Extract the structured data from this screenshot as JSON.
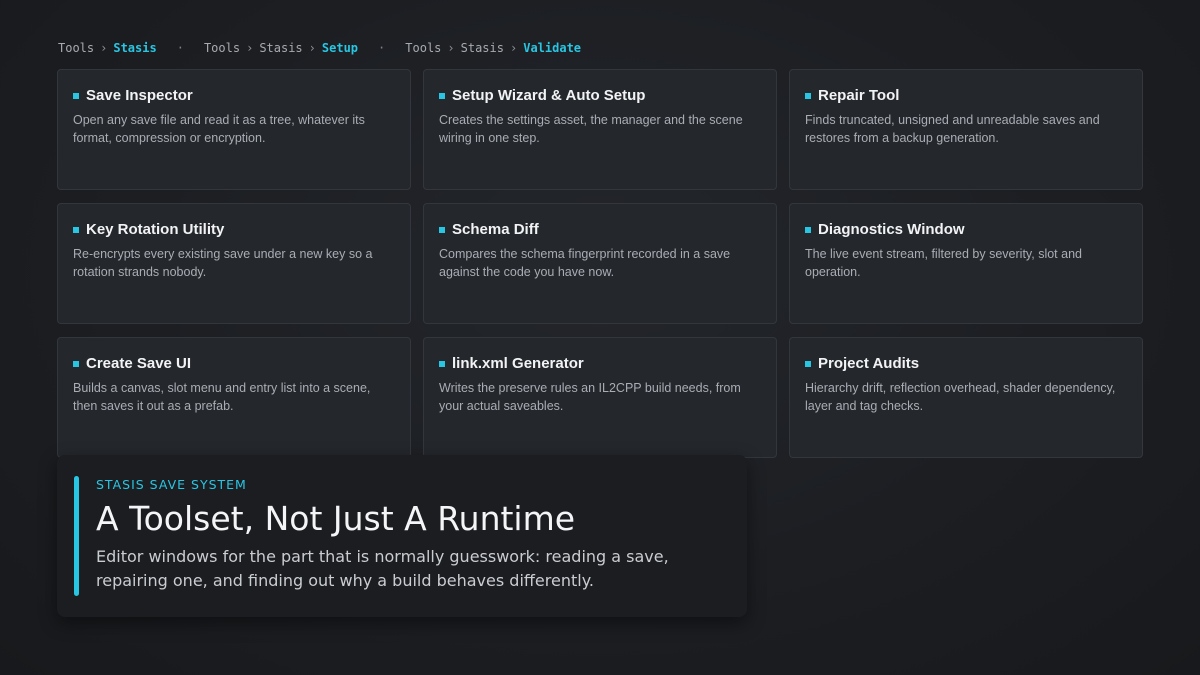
{
  "breadcrumbs": [
    {
      "parts": [
        "Tools",
        "Stasis"
      ]
    },
    {
      "parts": [
        "Tools",
        "Stasis",
        "Setup"
      ]
    },
    {
      "parts": [
        "Tools",
        "Stasis",
        "Validate"
      ]
    }
  ],
  "breadcrumb_separator": "›",
  "group_separator": "·",
  "cards": [
    {
      "title": "Save Inspector",
      "desc": "Open any save file and read it as a tree, whatever its format, compression or encryption."
    },
    {
      "title": "Setup Wizard & Auto Setup",
      "desc": "Creates the settings asset, the manager and the scene wiring in one step."
    },
    {
      "title": "Repair Tool",
      "desc": "Finds truncated, unsigned and unreadable saves and restores from a backup generation."
    },
    {
      "title": "Key Rotation Utility",
      "desc": "Re-encrypts every existing save under a new key so a rotation strands nobody."
    },
    {
      "title": "Schema Diff",
      "desc": "Compares the schema fingerprint recorded in a save against the code you have now."
    },
    {
      "title": "Diagnostics Window",
      "desc": "The live event stream, filtered by severity, slot and operation."
    },
    {
      "title": "Create Save UI",
      "desc": "Builds a canvas, slot menu and entry list into a scene, then saves it out as a prefab."
    },
    {
      "title": "link.xml Generator",
      "desc": "Writes the preserve rules an IL2CPP build needs, from your actual saveables."
    },
    {
      "title": "Project Audits",
      "desc": "Hierarchy drift, reflection overhead, shader dependency, layer and tag checks."
    }
  ],
  "callout": {
    "eyebrow": "STASIS SAVE SYSTEM",
    "title": "A Toolset, Not Just A Runtime",
    "body": "Editor windows for the part that is normally guesswork: reading a save, repairing one, and finding out why a build behaves differently."
  },
  "colors": {
    "accent": "#28c6e2",
    "background": "#1c1e22",
    "card": "#24272c"
  }
}
